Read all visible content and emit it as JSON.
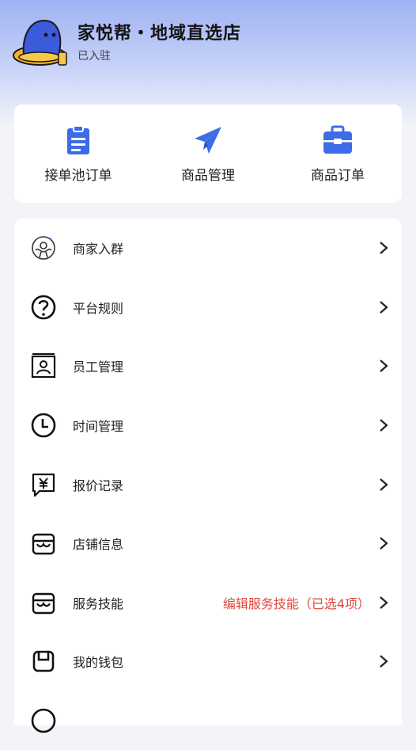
{
  "shop": {
    "name": "家悦帮・地域直选店",
    "status": "已入驻"
  },
  "quick_actions": [
    {
      "label": "接单池订单",
      "icon": "clipboard-icon"
    },
    {
      "label": "商品管理",
      "icon": "paper-plane-icon"
    },
    {
      "label": "商品订单",
      "icon": "briefcase-icon"
    }
  ],
  "menu": [
    {
      "label": "商家入群",
      "icon": "merchant-group-icon"
    },
    {
      "label": "平台规则",
      "icon": "question-icon"
    },
    {
      "label": "员工管理",
      "icon": "employee-icon"
    },
    {
      "label": "时间管理",
      "icon": "clock-icon"
    },
    {
      "label": "报价记录",
      "icon": "quote-yen-icon"
    },
    {
      "label": "店铺信息",
      "icon": "store-icon"
    },
    {
      "label": "服务技能",
      "icon": "store-icon",
      "extra": "编辑服务技能（已选4项）"
    },
    {
      "label": "我的钱包",
      "icon": "wallet-icon"
    }
  ],
  "colors": {
    "accent": "#3d6ce8",
    "extra_text": "#e0483d",
    "header_gradient_top": "#9fb2f3"
  }
}
